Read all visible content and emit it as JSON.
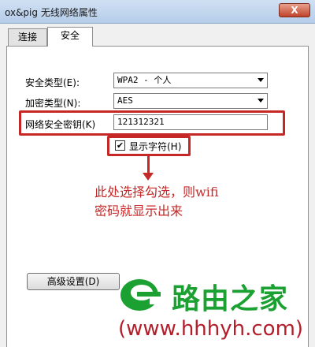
{
  "window": {
    "title": "ox&pig 无线网络属性",
    "close_label": "X"
  },
  "tabs": [
    {
      "label": "连接"
    },
    {
      "label": "安全"
    }
  ],
  "security": {
    "type_label": "安全类型(E):",
    "type_value": "WPA2 - 个人",
    "encryption_label": "加密类型(N):",
    "encryption_value": "AES",
    "key_label": "网络安全密钥(K)",
    "key_value": "121312321",
    "show_chars_label": "显示字符(H)",
    "show_chars_checked": true
  },
  "annotation": {
    "line1": "此处选择勾选，则wifi",
    "line2": "密码就显示出来"
  },
  "advanced_button_label": "高级设置(D)",
  "watermark": {
    "brand": "路由之家",
    "url": "(www.hhhyh.com)"
  },
  "colors": {
    "highlight": "#c62828",
    "brand_green": "#1aa131",
    "url_red": "#b21e2a"
  }
}
